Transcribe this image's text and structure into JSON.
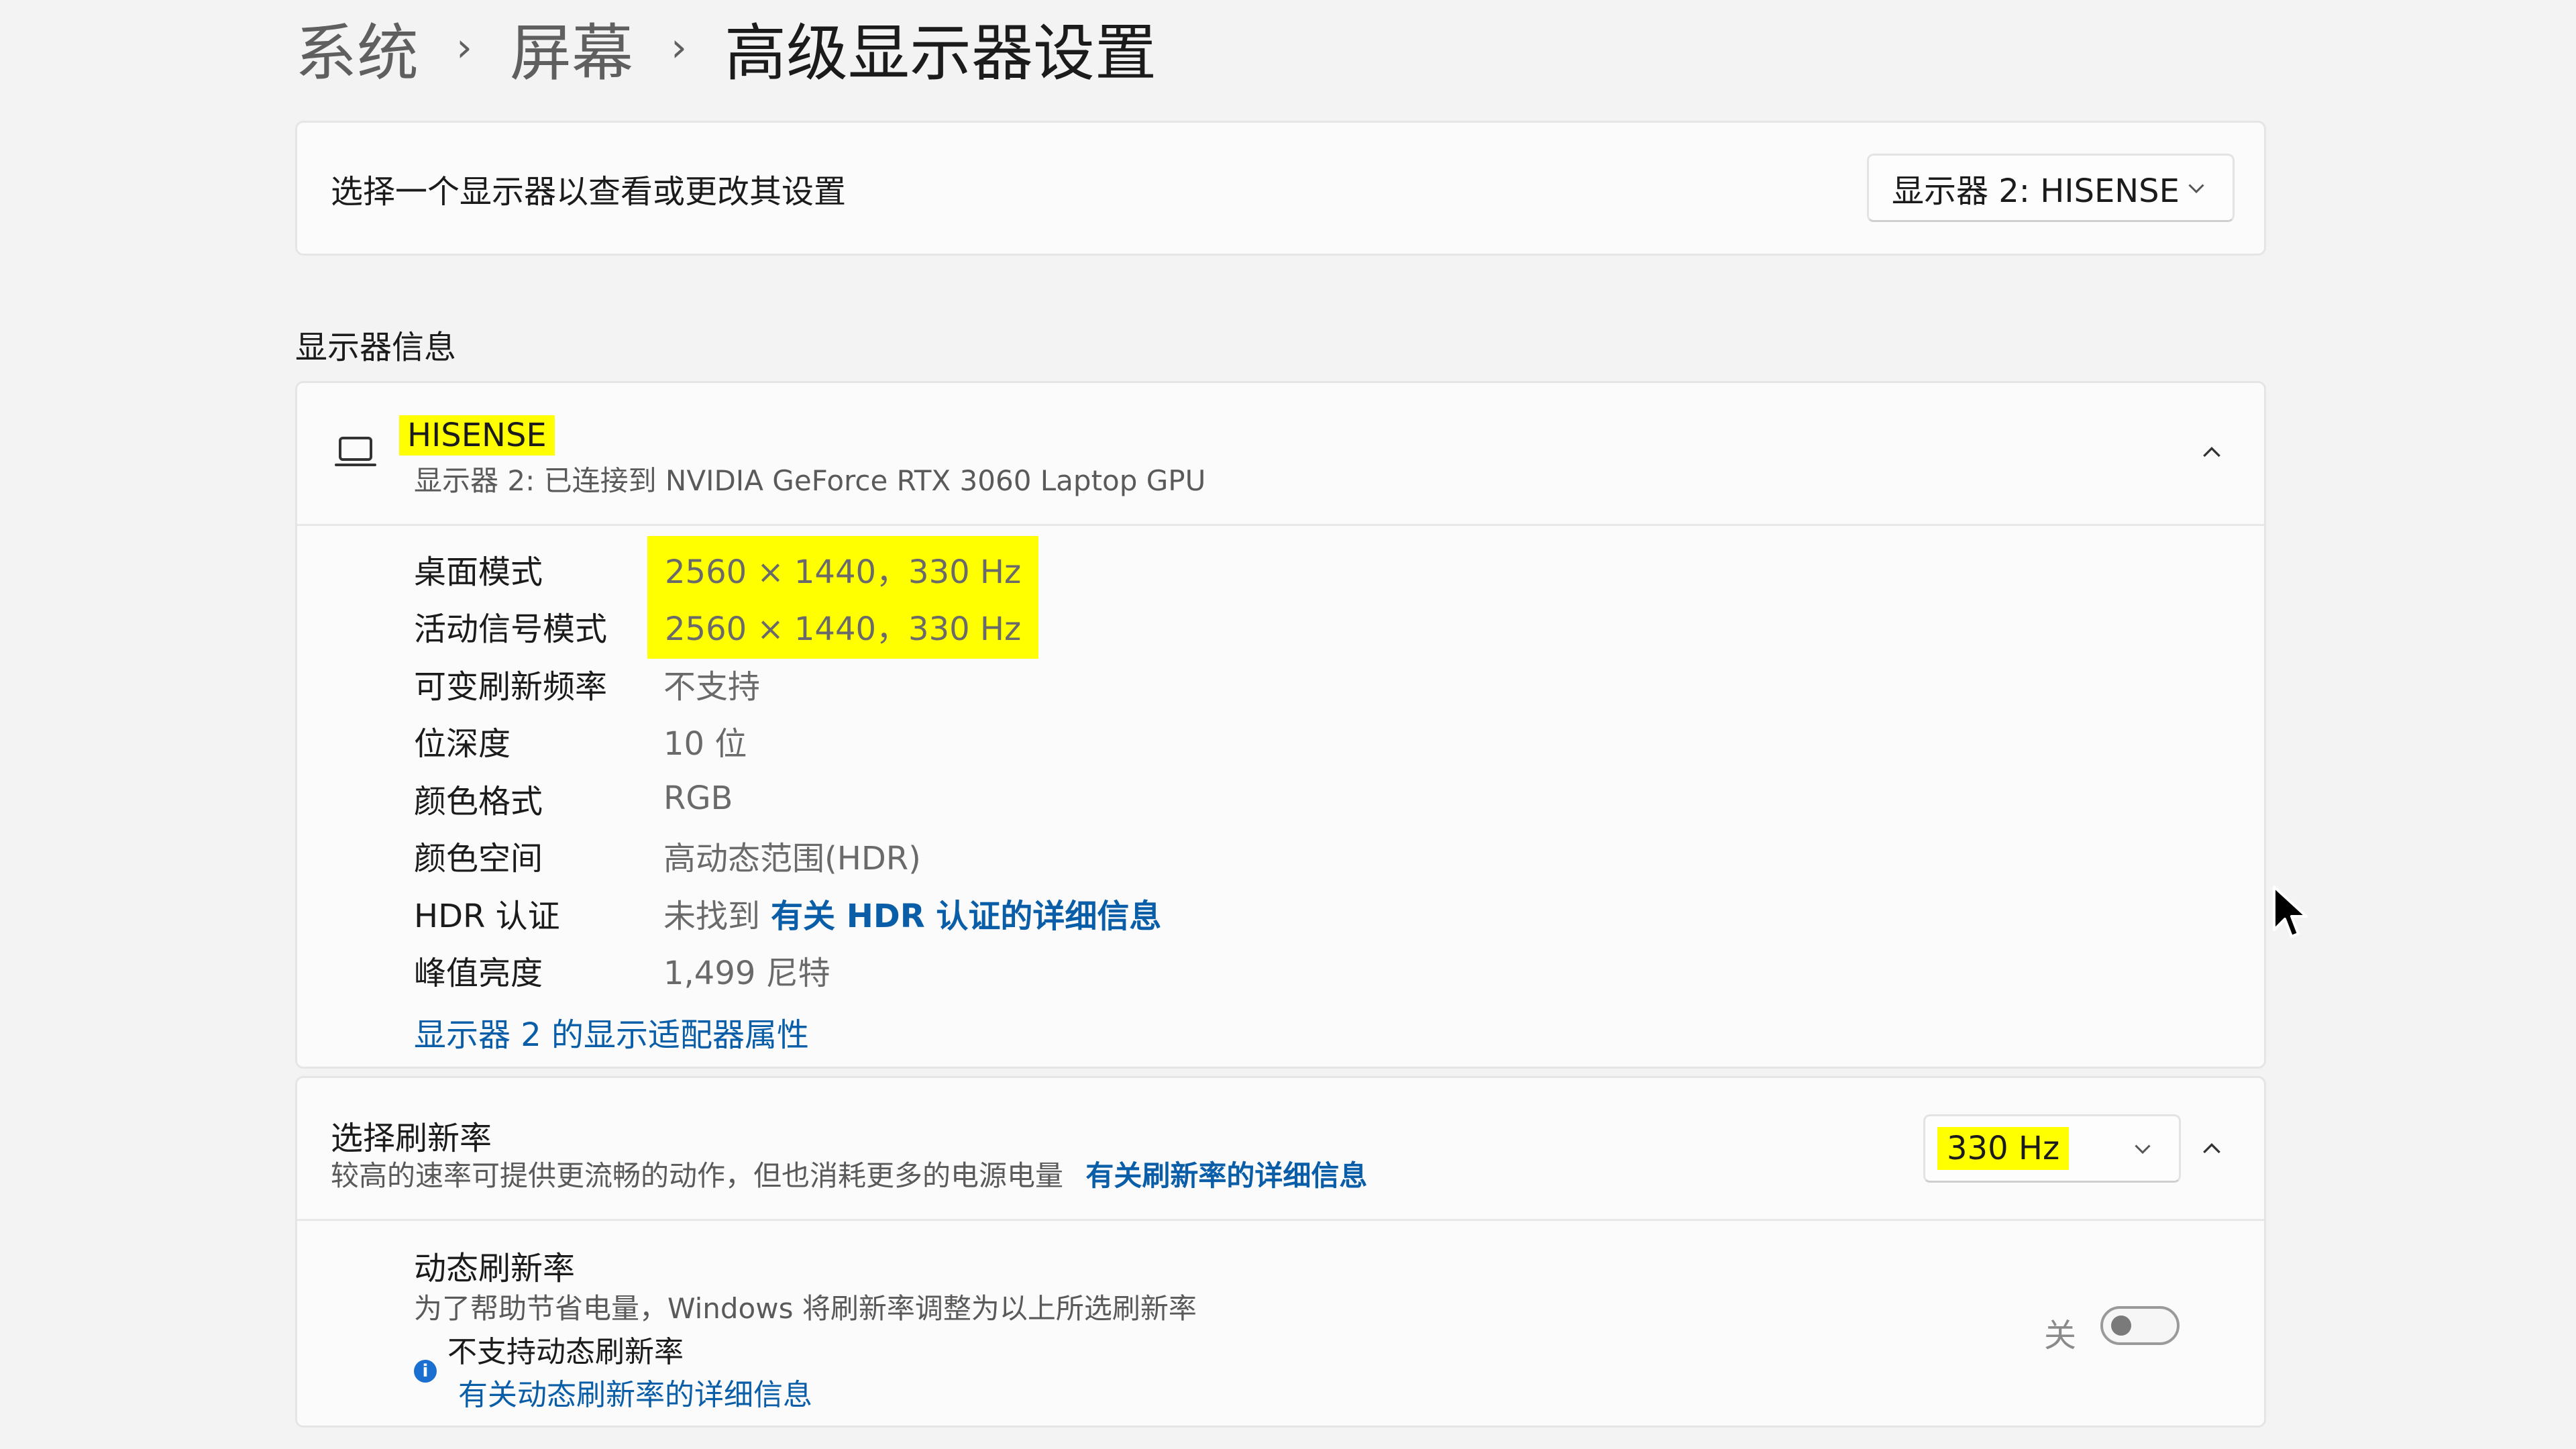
{
  "breadcrumb": {
    "items": [
      "系统",
      "屏幕"
    ],
    "current": "高级显示器设置",
    "separator": "›"
  },
  "display_selector": {
    "label": "选择一个显示器以查看或更改其设置",
    "selected": "显示器 2: HISENSE"
  },
  "display_info": {
    "section_title": "显示器信息",
    "monitor_name": "HISENSE",
    "monitor_subtitle": "显示器 2: 已连接到 NVIDIA GeForce RTX 3060 Laptop GPU",
    "rows": [
      {
        "label": "桌面模式",
        "value": "2560 × 1440，330 Hz"
      },
      {
        "label": "活动信号模式",
        "value": "2560 × 1440，330 Hz"
      },
      {
        "label": "可变刷新频率",
        "value": "不支持"
      },
      {
        "label": "位深度",
        "value": "10 位"
      },
      {
        "label": "颜色格式",
        "value": "RGB"
      },
      {
        "label": "颜色空间",
        "value": "高动态范围(HDR)"
      },
      {
        "label": "HDR 认证",
        "value": "未找到",
        "link": "有关 HDR 认证的详细信息"
      },
      {
        "label": "峰值亮度",
        "value": "1,499 尼特"
      }
    ],
    "adapter_link": "显示器 2 的显示适配器属性"
  },
  "refresh_rate": {
    "title": "选择刷新率",
    "description": "较高的速率可提供更流畅的动作，但也消耗更多的电源电量",
    "link": "有关刷新率的详细信息",
    "selected": "330 Hz"
  },
  "dynamic_refresh": {
    "title": "动态刷新率",
    "description": "为了帮助节省电量，Windows 将刷新率调整为以上所选刷新率",
    "not_supported": "不支持动态刷新率",
    "link": "有关动态刷新率的详细信息",
    "toggle_label": "关",
    "toggle_on": false
  },
  "colors": {
    "highlight": "#ffff00",
    "link": "#0a5ea8",
    "background": "#f3f3f3"
  }
}
